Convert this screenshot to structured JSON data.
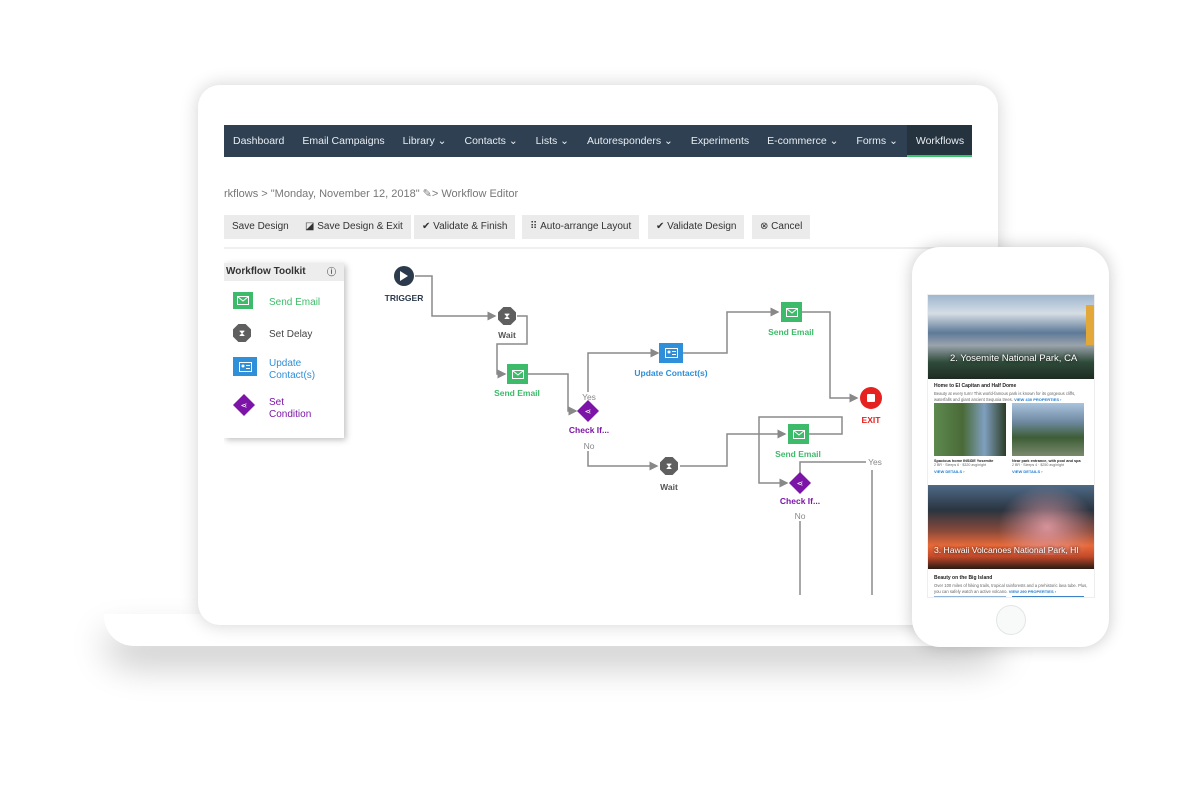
{
  "nav": {
    "items": [
      {
        "label": "Dashboard"
      },
      {
        "label": "Email Campaigns"
      },
      {
        "label": "Library ⌄"
      },
      {
        "label": "Contacts ⌄"
      },
      {
        "label": "Lists ⌄"
      },
      {
        "label": "Autoresponders ⌄"
      },
      {
        "label": "Experiments"
      },
      {
        "label": "E-commerce ⌄"
      },
      {
        "label": "Forms ⌄"
      },
      {
        "label": "Workflows"
      }
    ],
    "active": "Workflows",
    "accent": "#39c36c"
  },
  "breadcrumb": "rkflows > \"Monday, November 12, 2018\" ✎> Workflow Editor",
  "toolbar": {
    "save": "Save Design",
    "save_exit": "◪ Save Design & Exit",
    "validate_finish": "✔ Validate & Finish",
    "auto_arrange": "⠿ Auto-arrange Layout",
    "validate": "✔ Validate Design",
    "cancel": "⊗ Cancel"
  },
  "toolkit": {
    "title": "Workflow Toolkit",
    "info_icon": "info-icon",
    "items": [
      {
        "label": "Send Email",
        "color": "#3dbb6a"
      },
      {
        "label": "Set Delay",
        "color": "#444444"
      },
      {
        "label": "Update Contact(s)",
        "color": "#2f8fd8"
      },
      {
        "label": "Set Condition",
        "color": "#7d14a8"
      }
    ]
  },
  "workflow": {
    "trigger": "TRIGGER",
    "wait": "Wait",
    "send_email": "Send Email",
    "check_if": "Check If...",
    "yes": "Yes",
    "no": "No",
    "update_contacts": "Update Contact(s)",
    "exit": "EXIT"
  },
  "colors": {
    "email": "#3dbb6a",
    "delay": "#5f5f5f",
    "contact": "#2f8fd8",
    "condition": "#7d14a8",
    "exit": "#e5221f",
    "trigger": "#2b3a4c"
  },
  "phone": {
    "section1": {
      "title": "2. Yosemite National Park, CA",
      "heading": "Home to El Capitan and Half Dome",
      "body": "Beauty at every turn! This world-famous park is known for its gorgeous cliffs, waterfalls and giant ancient Sequoia trees.",
      "link": "VIEW 430 PROPERTIES ›",
      "listings": [
        {
          "title": "Spacious home INSIDE Yosemite",
          "meta": "2 BR · Sleeps 6 · $320 avg/night",
          "link": "VIEW DETAILS ›"
        },
        {
          "title": "Near park entrance, with pool and spa",
          "meta": "2 BR · Sleeps 4 · $250 avg/night",
          "link": "VIEW DETAILS ›"
        }
      ]
    },
    "section2": {
      "title": "3. Hawaii Volcanoes National Park, HI",
      "heading": "Beauty on the Big Island",
      "body": "Over 100 miles of hiking trails, tropical rainforests and a prehistoric lava tube. Plus, you can safely watch an active volcano.",
      "link": "VIEW 290 PROPERTIES ›"
    }
  }
}
